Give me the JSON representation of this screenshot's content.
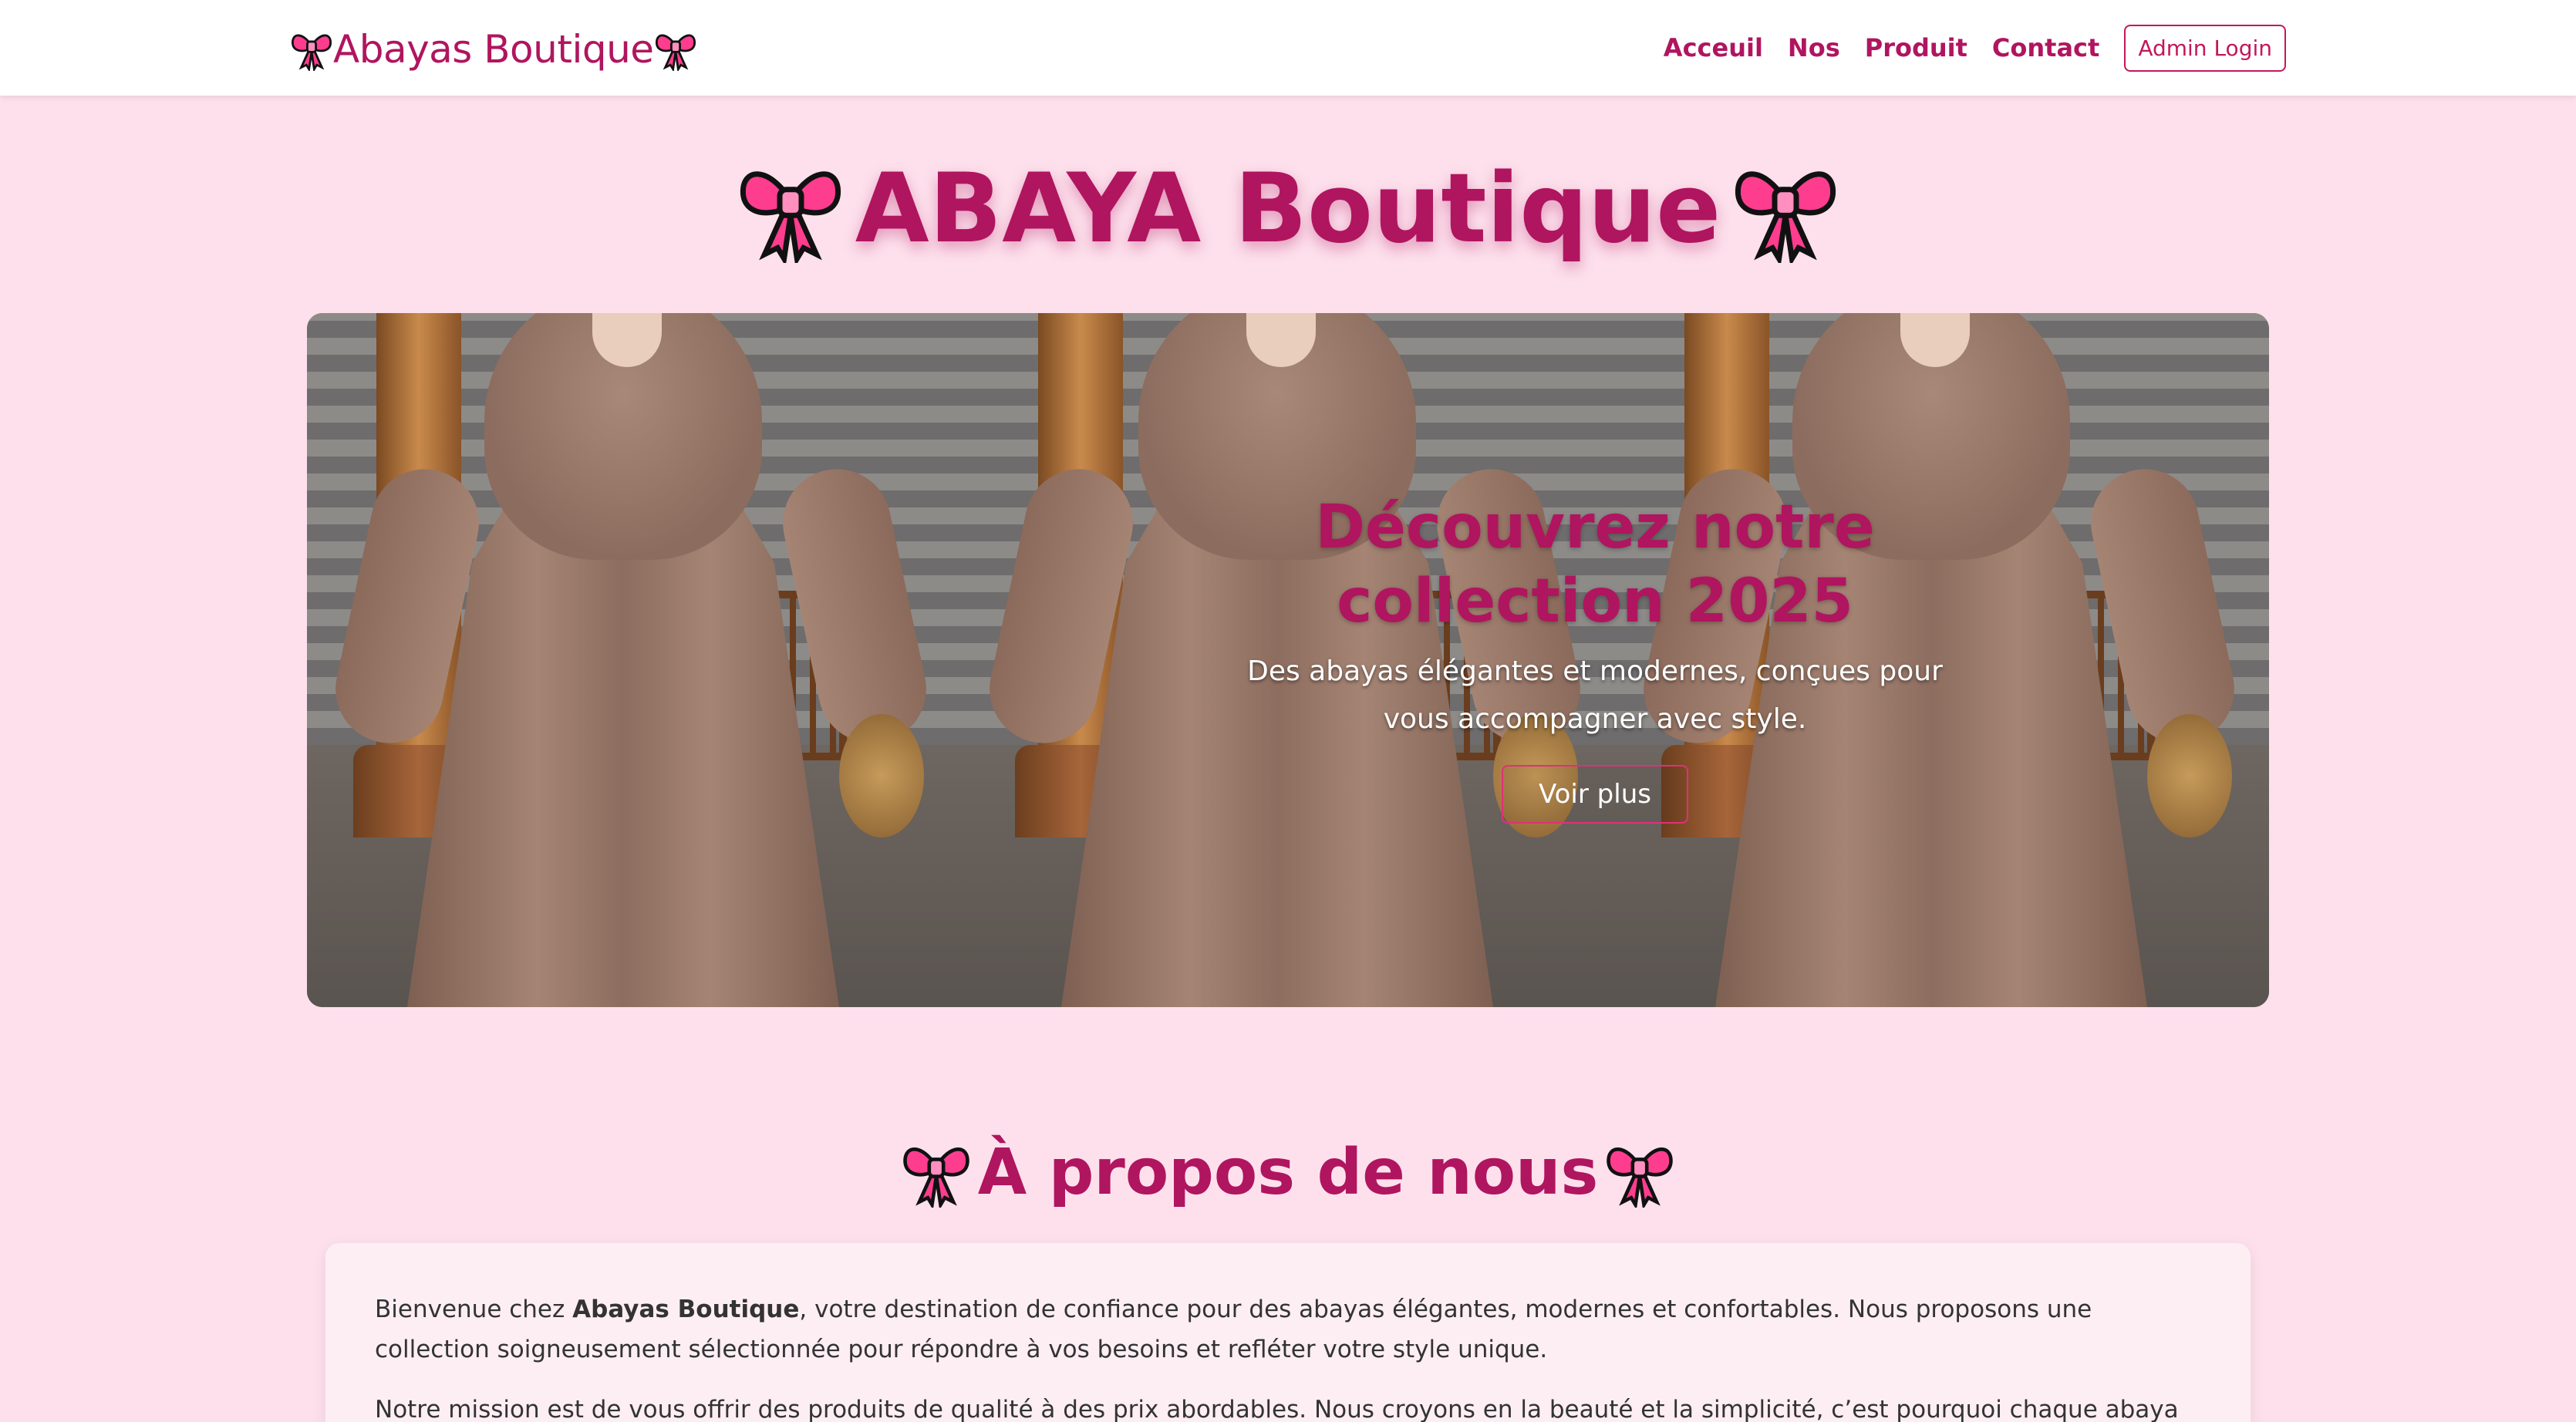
{
  "navbar": {
    "brand": "Abayas Boutique",
    "links": [
      "Acceuil",
      "Nos",
      "Produit",
      "Contact"
    ],
    "admin_button": "Admin Login"
  },
  "hero": {
    "title": "ABAYA Boutique"
  },
  "carousel": {
    "heading": "Découvrez notre collection 2025",
    "subtitle": "Des abayas élégantes et modernes, conçues pour vous accompagner avec style.",
    "button": "Voir plus"
  },
  "about": {
    "title": "À propos de nous",
    "p1_prefix": "Bienvenue chez ",
    "p1_bold": "Abayas Boutique",
    "p1_suffix": ", votre destination de confiance pour des abayas élégantes, modernes et confortables. Nous proposons une collection soigneusement sélectionnée pour répondre à vos besoins et refléter votre style unique.",
    "p2": "Notre mission est de vous offrir des produits de qualité à des prix abordables. Nous croyons en la beauté et la simplicité, c’est pourquoi chaque abaya est conçue avec"
  },
  "colors": {
    "accent": "#b0155f",
    "background": "#fde0ec",
    "bow": "#ff3d8f"
  },
  "icons": [
    "ribbon-bow-icon"
  ]
}
